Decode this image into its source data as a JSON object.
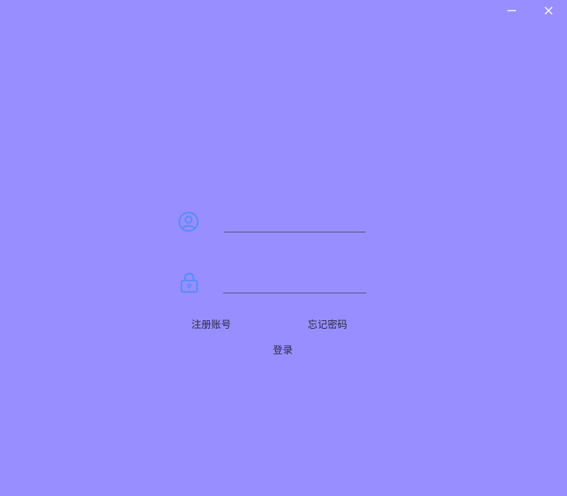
{
  "window": {
    "background": "#998eff",
    "controls": {
      "minimize_icon": "minimize-icon",
      "close_icon": "close-icon"
    }
  },
  "login_form": {
    "icon_color": "#5b8cff",
    "username": {
      "icon": "user-circle-icon",
      "value": "",
      "placeholder": ""
    },
    "password": {
      "icon": "lock-icon",
      "value": "",
      "placeholder": ""
    },
    "register_label": "注册账号",
    "forgot_label": "忘记密码",
    "login_label": "登录"
  }
}
